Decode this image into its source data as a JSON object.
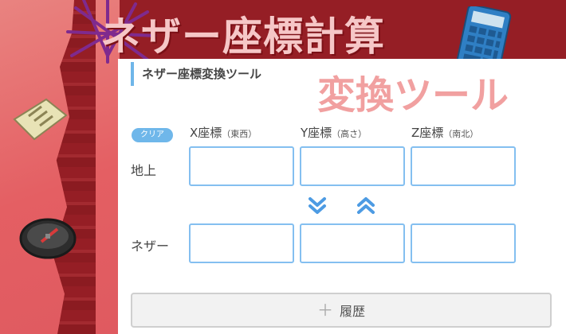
{
  "headline": {
    "line1": "ネザー座標計算",
    "line2": "変換ツール"
  },
  "tool": {
    "title": "ネザー座標変換ツール",
    "clear_label": "クリア",
    "columns": [
      {
        "main": "X座標",
        "sub": "（東西）"
      },
      {
        "main": "Y座標",
        "sub": "（高さ）"
      },
      {
        "main": "Z座標",
        "sub": "（南北）"
      }
    ],
    "rows": [
      {
        "label": "地上",
        "values": [
          "",
          "",
          ""
        ]
      },
      {
        "label": "ネザー",
        "values": [
          "",
          "",
          ""
        ]
      }
    ],
    "history_label": "履歴",
    "history_icon": "plus-icon"
  },
  "colors": {
    "accent": "#6fb7ea",
    "background_red": "#951e25",
    "background_pink": "#e7706f"
  }
}
